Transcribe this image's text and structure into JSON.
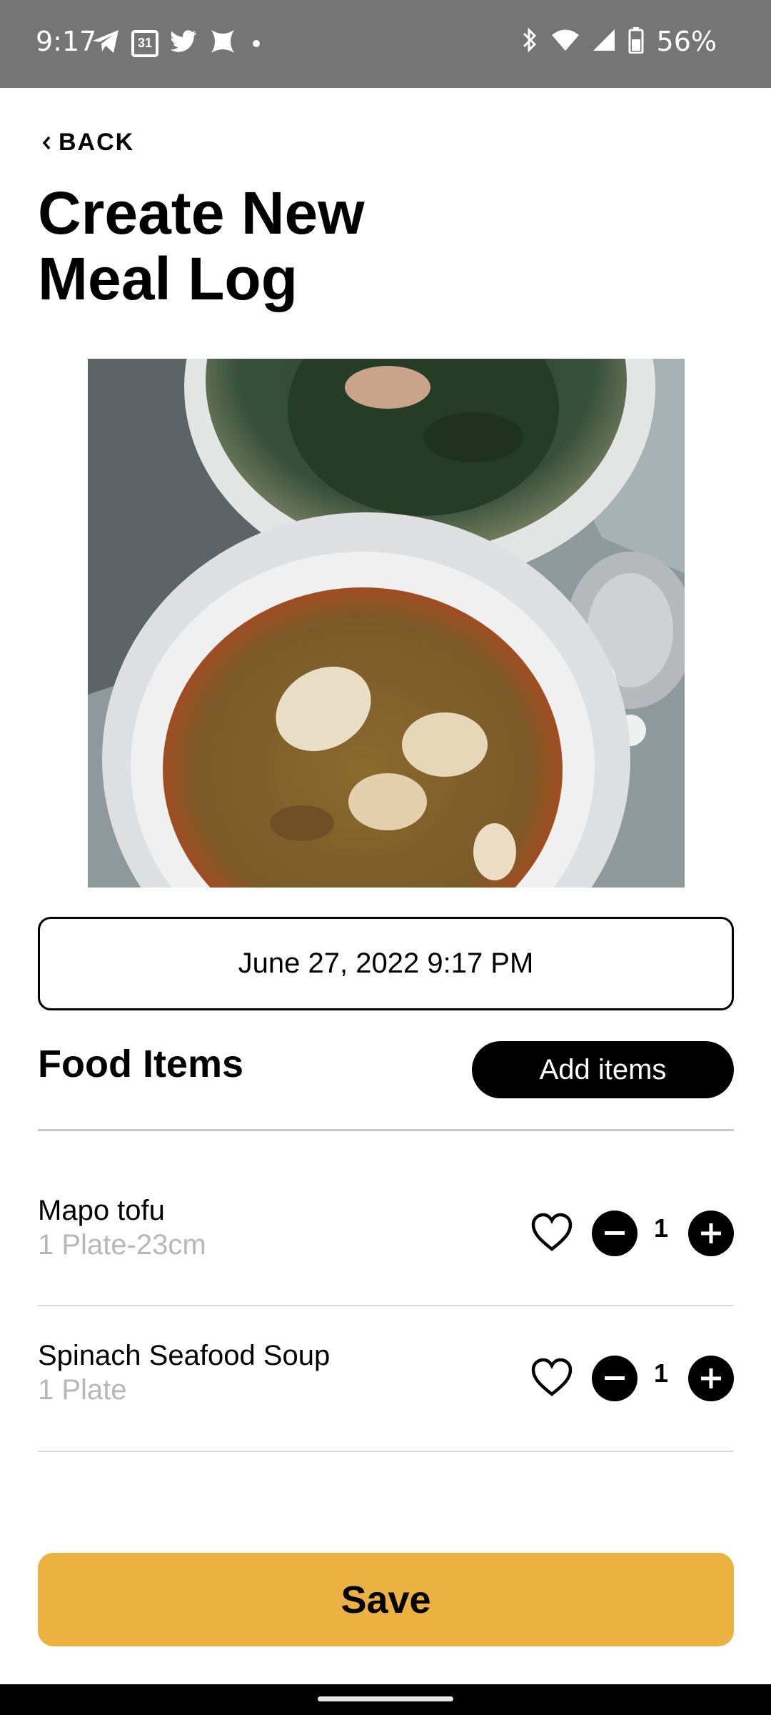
{
  "status_bar": {
    "time": "9:17",
    "calendar_day": "31",
    "battery": "56%",
    "left_icons": [
      "telegram-icon",
      "calendar-icon",
      "twitter-icon",
      "app-x-icon",
      "notification-dot"
    ],
    "right_icons": [
      "bluetooth-icon",
      "wifi-icon",
      "signal-icon",
      "battery-icon"
    ]
  },
  "header": {
    "back_label": "BACK",
    "title": "Create New Meal Log"
  },
  "photo": {
    "description": "food-photo",
    "icon": "meal-photo"
  },
  "date_field": {
    "value": "June 27, 2022 9:17 PM"
  },
  "food_section": {
    "title": "Food Items",
    "add_label": "Add items",
    "items": [
      {
        "name": "Mapo tofu",
        "portion": "1 Plate-23cm",
        "quantity": "1"
      },
      {
        "name": "Spinach Seafood Soup",
        "portion": "1 Plate",
        "quantity": "1"
      }
    ]
  },
  "save_label": "Save",
  "colors": {
    "accent": "#ebb242",
    "status_bar": "#757575",
    "muted_text": "#b7b7b7",
    "divider": "#c8c8c8"
  }
}
